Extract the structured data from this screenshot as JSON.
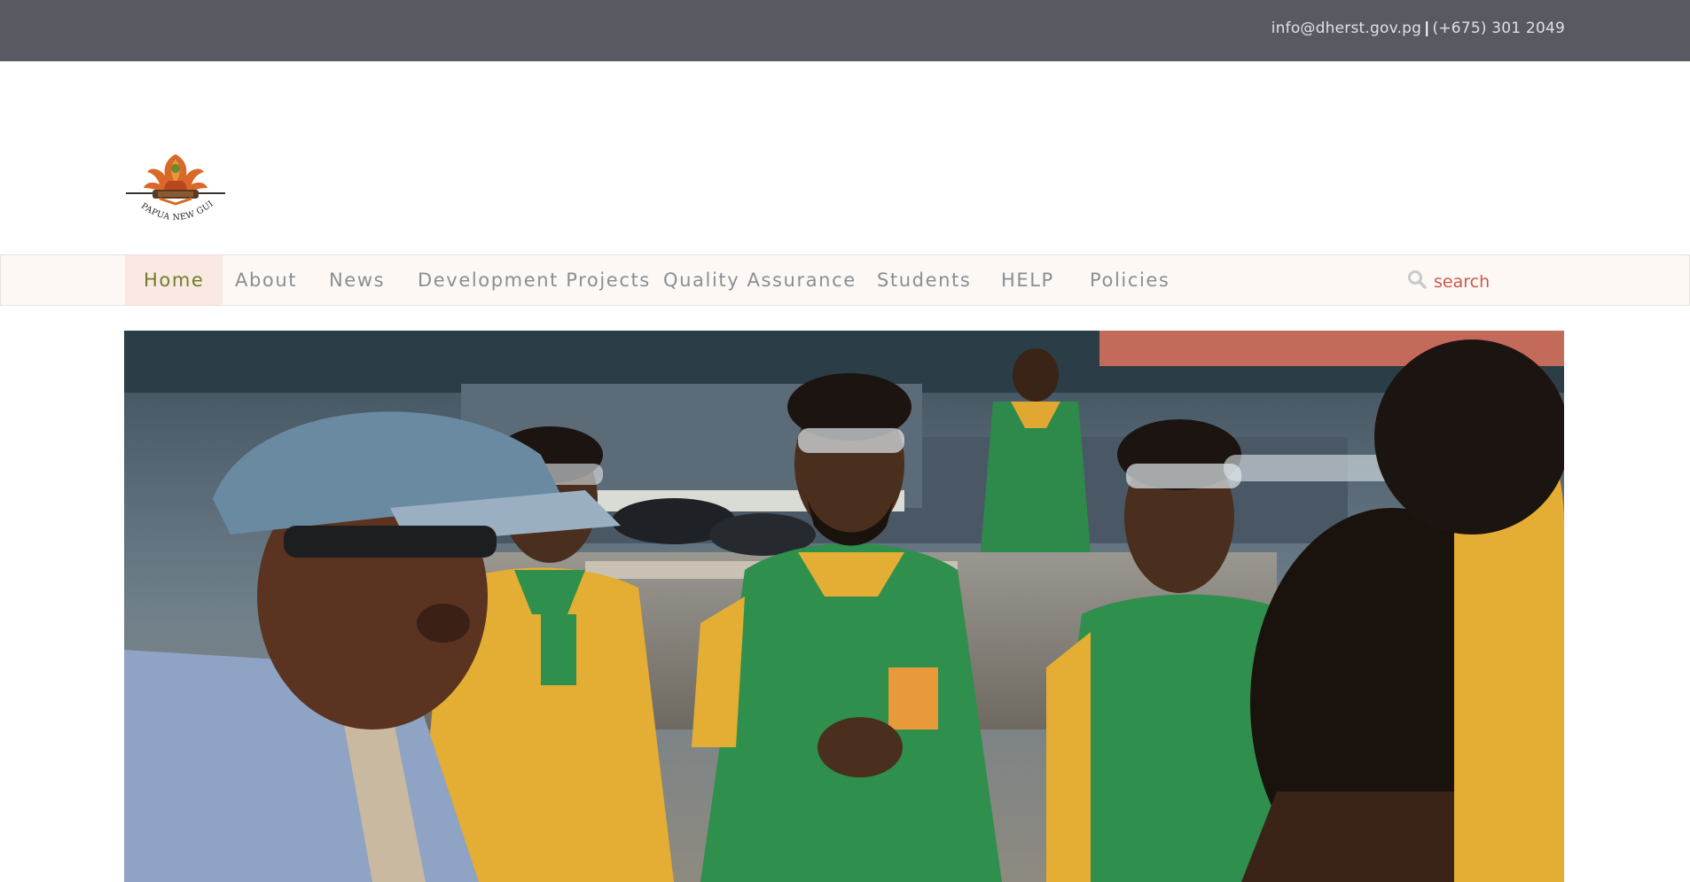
{
  "topbar": {
    "email": "info@dherst.gov.pg",
    "separator": "|",
    "phone": "(+675) 301 2049",
    "background": "#575b61"
  },
  "logo": {
    "caption": "PAPUA NEW GUINEA",
    "icon": "png-national-emblem-icon"
  },
  "nav": {
    "items": [
      {
        "label": "Home",
        "active": true
      },
      {
        "label": "About",
        "active": false
      },
      {
        "label": "News",
        "active": false
      },
      {
        "label": "Development Projects",
        "active": false
      },
      {
        "label": "Quality Assurance",
        "active": false
      },
      {
        "label": "Students",
        "active": false
      },
      {
        "label": "HELP",
        "active": false
      },
      {
        "label": "Policies",
        "active": false
      }
    ],
    "active_color": "#6e7e2a",
    "text_color": "#8a8e93"
  },
  "search": {
    "placeholder": "search",
    "icon": "search-icon"
  },
  "hero": {
    "scene": "hero-photo-students-workshop"
  }
}
